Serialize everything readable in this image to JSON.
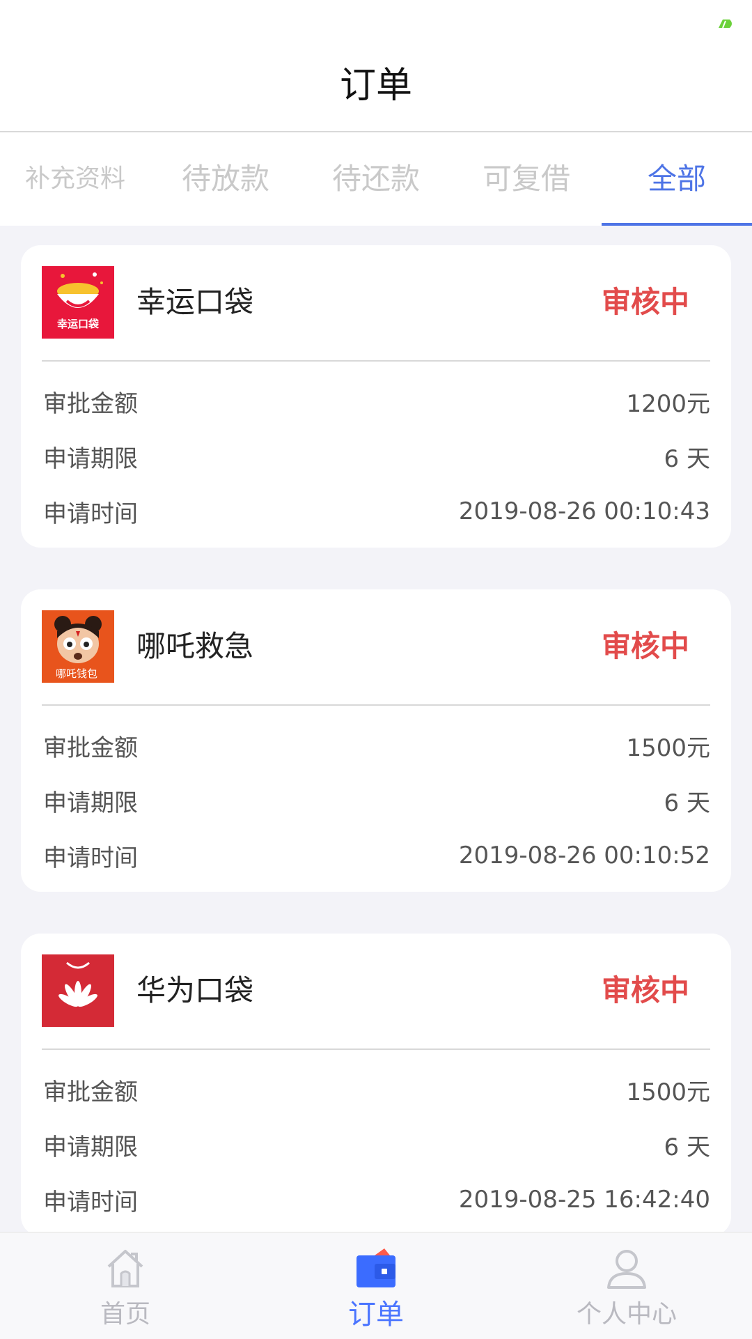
{
  "header": {
    "title": "订单"
  },
  "tabs": [
    {
      "label": "补充资料",
      "active": false
    },
    {
      "label": "待放款",
      "active": false
    },
    {
      "label": "待还款",
      "active": false
    },
    {
      "label": "可复借",
      "active": false
    },
    {
      "label": "全部",
      "active": true
    }
  ],
  "labels": {
    "amount": "审批金额",
    "term": "申请期限",
    "time": "申请时间"
  },
  "orders": [
    {
      "name": "幸运口袋",
      "status": "审核中",
      "amount": "1200元",
      "term": "6 天",
      "time": "2019-08-26 00:10:43",
      "logo_text": "幸运口袋"
    },
    {
      "name": "哪吒救急",
      "status": "审核中",
      "amount": "1500元",
      "term": "6 天",
      "time": "2019-08-26 00:10:52",
      "logo_text": "哪吒钱包"
    },
    {
      "name": "华为口袋",
      "status": "审核中",
      "amount": "1500元",
      "term": "6 天",
      "time": "2019-08-25 16:42:40",
      "logo_text": ""
    }
  ],
  "tabbar": [
    {
      "label": "首页",
      "icon": "home-icon",
      "active": false
    },
    {
      "label": "订单",
      "icon": "wallet-icon",
      "active": true
    },
    {
      "label": "个人中心",
      "icon": "user-icon",
      "active": false
    }
  ],
  "colors": {
    "accent": "#4e74e6",
    "status_red": "#e24b4b",
    "background": "#f3f3f8"
  }
}
